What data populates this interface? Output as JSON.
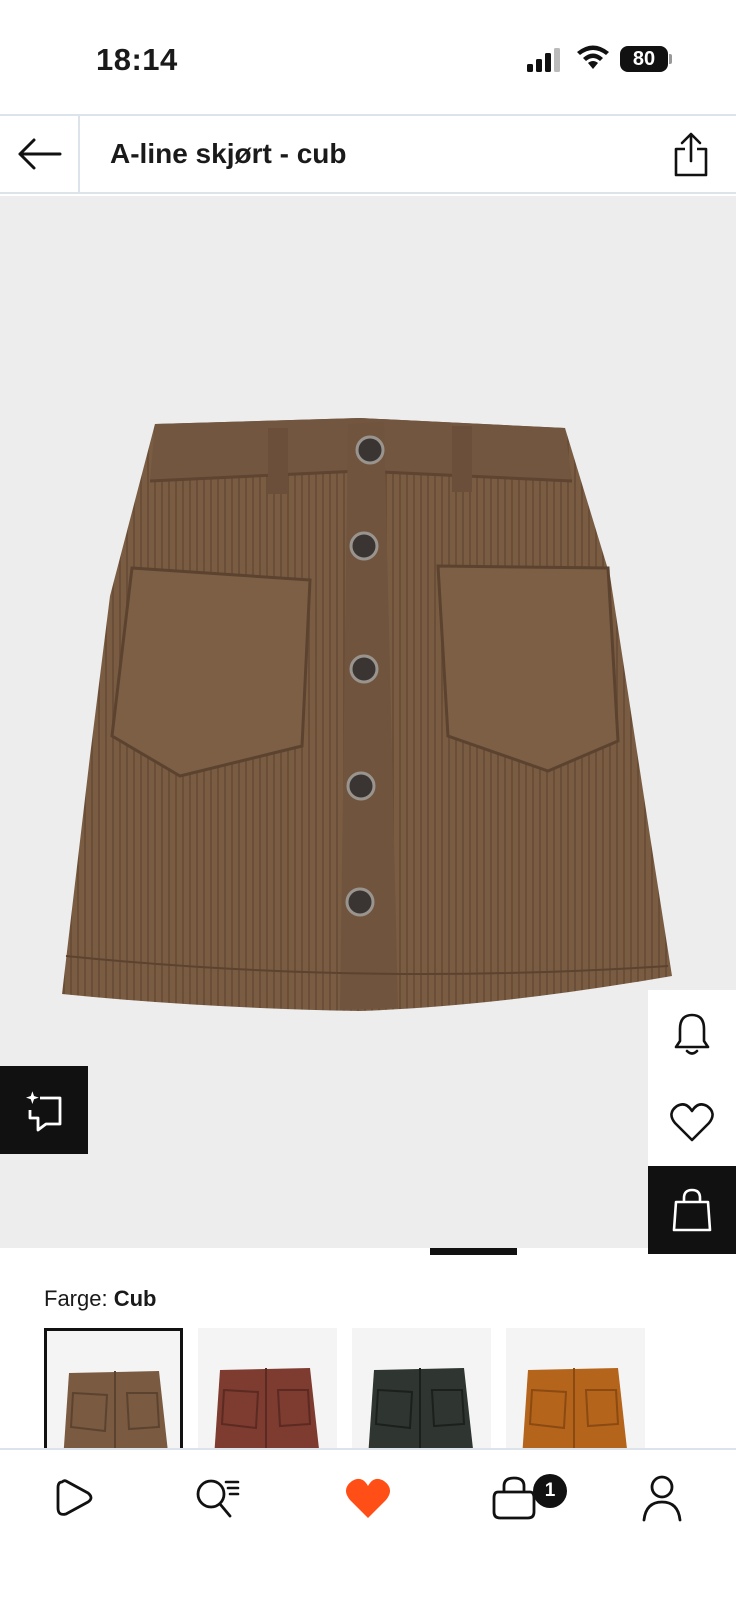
{
  "status_bar": {
    "time": "18:14",
    "battery": "80"
  },
  "header": {
    "title": "A-line skjørt - cub",
    "back_icon": "arrow-left-icon",
    "share_icon": "share-icon"
  },
  "product": {
    "image": "brown corduroy a-line skirt"
  },
  "side_actions": [
    {
      "icon": "bell-icon"
    },
    {
      "icon": "heart-outline-icon"
    },
    {
      "icon": "shopping-bag-icon"
    }
  ],
  "try_on": {
    "icon": "virtual-try-on-icon"
  },
  "color": {
    "label": "Farge: ",
    "value": "Cub",
    "swatches": [
      {
        "color": "#7a5a40",
        "selected": true
      },
      {
        "color": "#7e3b30",
        "selected": false
      },
      {
        "color": "#2f3530",
        "selected": false
      },
      {
        "color": "#b5641c",
        "selected": false
      }
    ]
  },
  "bottom_nav": {
    "items": [
      {
        "icon": "play-icon"
      },
      {
        "icon": "search-icon"
      },
      {
        "icon": "heart-filled-icon",
        "color": "#ff4f17"
      },
      {
        "icon": "bag-icon"
      },
      {
        "icon": "profile-icon"
      }
    ],
    "cart_count": "1"
  }
}
